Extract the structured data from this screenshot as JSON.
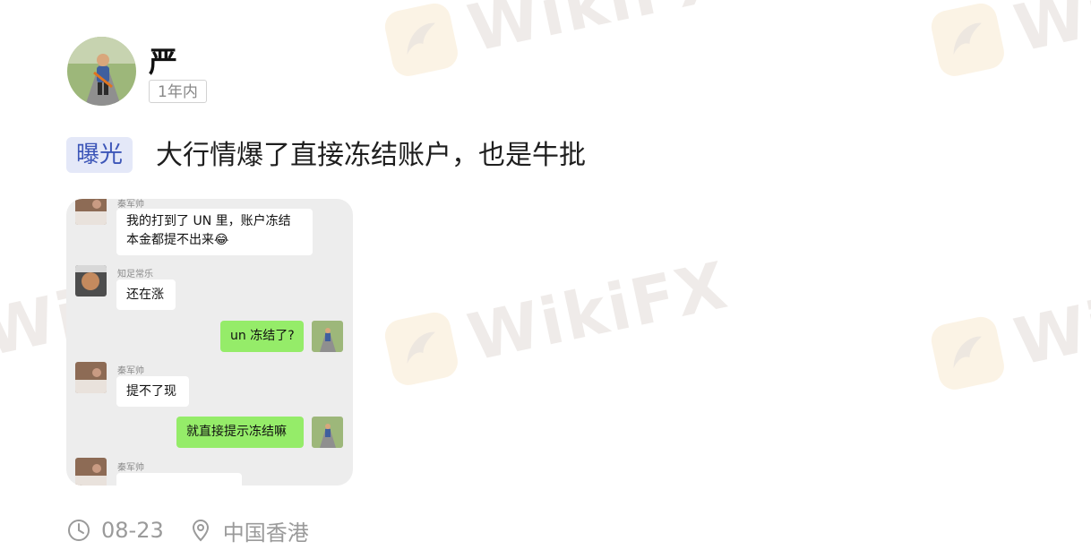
{
  "watermark": {
    "brand": "WikiFX"
  },
  "post": {
    "username": "严",
    "time_label": "1年内",
    "tag": "曝光",
    "text": "大行情爆了直接冻结账户，也是牛批"
  },
  "chat": {
    "messages": [
      {
        "side": "left",
        "sender": "秦军帅",
        "lines": [
          "我的打到了 UN 里，账户冻结",
          "本金都提不出来😂"
        ]
      },
      {
        "side": "left",
        "sender": "知足常乐",
        "lines": [
          "还在涨"
        ]
      },
      {
        "side": "right",
        "sender": "",
        "lines": [
          "un 冻结了?"
        ]
      },
      {
        "side": "left",
        "sender": "秦军帅",
        "lines": [
          "提不了现"
        ]
      },
      {
        "side": "right",
        "sender": "",
        "lines": [
          "就直接提示冻结嘛"
        ]
      },
      {
        "side": "left",
        "sender": "秦军帅",
        "lines": [
          ""
        ]
      }
    ]
  },
  "footer": {
    "date": "08-23",
    "location": "中国香港",
    "clock_icon": "clock-icon",
    "location_icon": "location-pin-icon"
  }
}
